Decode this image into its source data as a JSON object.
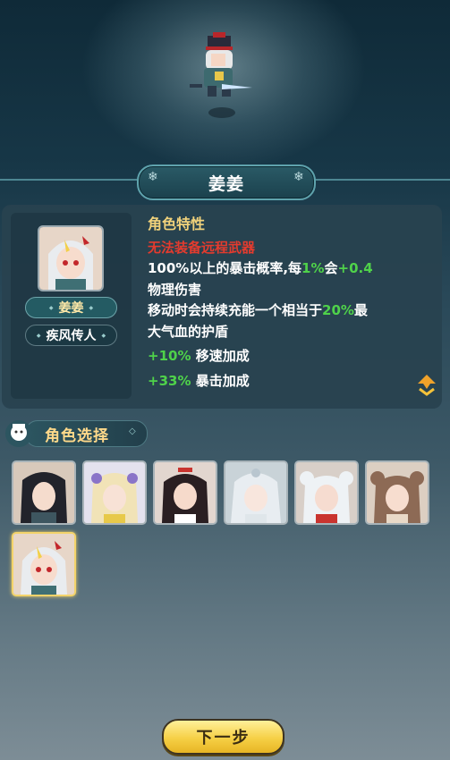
{
  "hero_name": "姜姜",
  "traits": {
    "heading": "角色特性",
    "restriction": "无法装备远程武器",
    "line1": {
      "a": "100%以上的暴击概率,每",
      "b": "1%",
      "c": "会",
      "d": "+0.4"
    },
    "line2": "物理伤害",
    "line3": {
      "a": "移动时会持续充能一个相当于",
      "b": "20%",
      "c": "最"
    },
    "line4": "大气血的护盾",
    "bonus1": {
      "value": "+10%",
      "label": "移速加成"
    },
    "bonus2": {
      "value": "+33%",
      "label": "暴击加成"
    }
  },
  "portrait_tags": {
    "name": "姜姜",
    "title": "疾风传人"
  },
  "select_section": {
    "label": "角色选择"
  },
  "roster": [
    {
      "icon": "character-black-hair-male-icon"
    },
    {
      "icon": "character-blonde-flower-icon"
    },
    {
      "icon": "character-dark-hair-female-icon"
    },
    {
      "icon": "character-silver-hair-female-icon"
    },
    {
      "icon": "character-white-hair-buns-icon"
    },
    {
      "icon": "character-brown-hair-buns-icon"
    },
    {
      "icon": "character-jiangjiang-icon",
      "selected": true
    }
  ],
  "next_button": "下一步",
  "colors": {
    "accent_gold": "#f1d27b",
    "red": "#e43b2e",
    "green": "#4fd24a",
    "button": "#f6d046"
  }
}
